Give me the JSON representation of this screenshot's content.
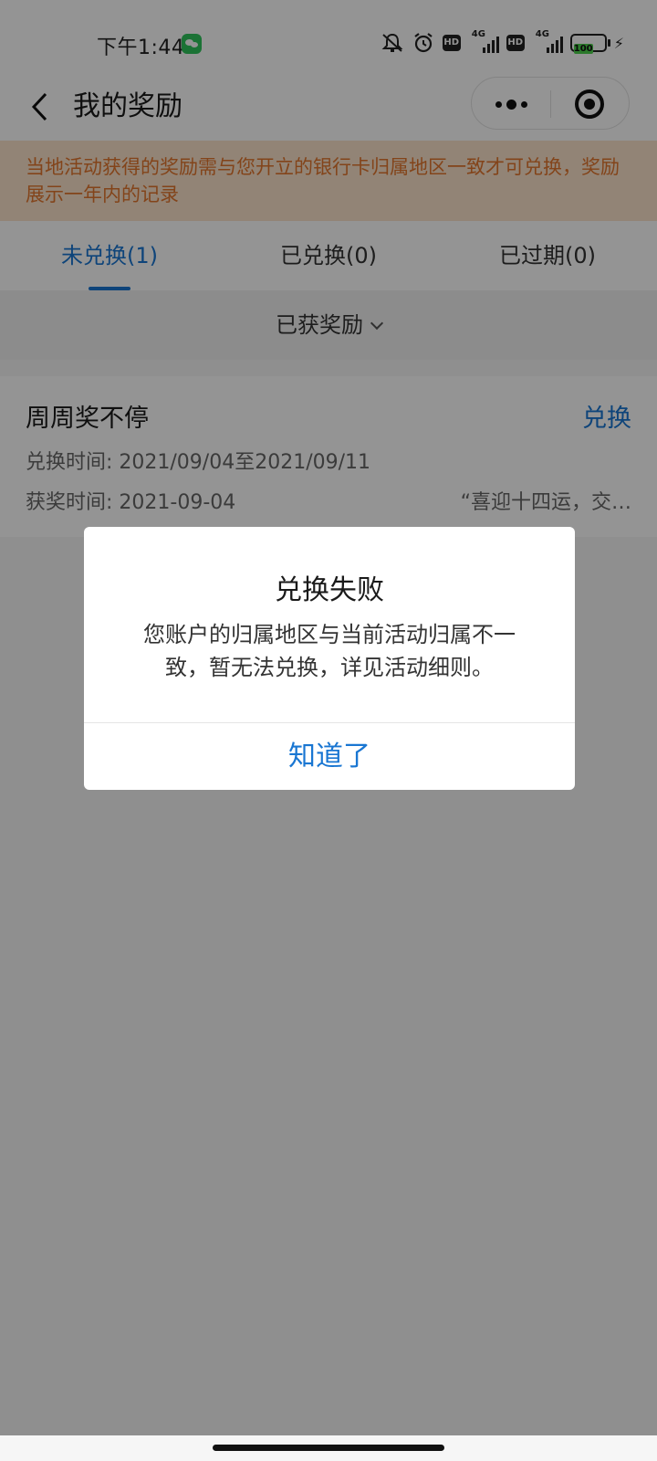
{
  "status_bar": {
    "time": "下午1:44",
    "network_label_1": "4G",
    "network_label_2": "4G",
    "hd_label": "HD",
    "battery_level": "100"
  },
  "navbar": {
    "title": "我的奖励"
  },
  "notice": {
    "text": "当地活动获得的奖励需与您开立的银行卡归属地区一致才可兑换，奖励展示一年内的记录"
  },
  "tabs": [
    {
      "label": "未兑换(1)",
      "active": true
    },
    {
      "label": "已兑换(0)",
      "active": false
    },
    {
      "label": "已过期(0)",
      "active": false
    }
  ],
  "filter": {
    "label": "已获奖励"
  },
  "reward": {
    "name": "周周奖不停",
    "action": "兑换",
    "exchange_time": "兑换时间: 2021/09/04至2021/09/11",
    "award_time": "获奖时间: 2021-09-04",
    "slogan": "“喜迎十四运，交…"
  },
  "dialog": {
    "title": "兑换失败",
    "message": "您账户的归属地区与当前活动归属不一致，暂无法兑换，详见活动细则。",
    "confirm": "知道了"
  },
  "colors": {
    "accent": "#1976d2",
    "notice_text": "#e2762d",
    "notice_bg": "#fbe3cc"
  }
}
